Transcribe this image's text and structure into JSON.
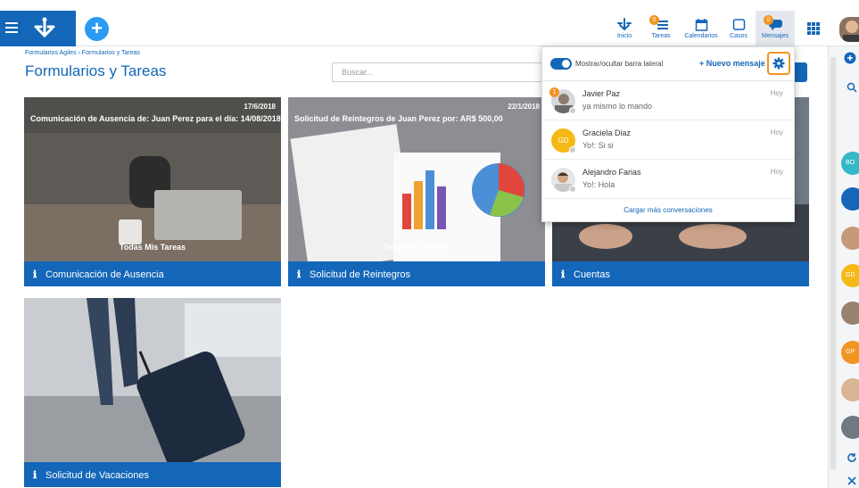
{
  "header": {
    "nav": [
      {
        "label": "Inicio"
      },
      {
        "label": "Tareas",
        "badge": "0"
      },
      {
        "label": "Calendarios"
      },
      {
        "label": "Casos"
      },
      {
        "label": "Mensajes",
        "badge": "0"
      }
    ]
  },
  "page": {
    "breadcrumb": "Formularios Agiles › Formularios y Tareas",
    "title": "Formularios y Tareas",
    "search_placeholder": "Buscar..."
  },
  "cards": [
    {
      "date": "17/6/2018",
      "description": "Comunicación de Ausencia de: Juan Perez para el día: 14/08/2018",
      "all_tasks": "Todas Mis Tareas",
      "label": "Comunicación de Ausencia"
    },
    {
      "date": "22/1/2018",
      "description": "Solicitud de Reintegros de Juan Perez por: AR$ 500,00",
      "all_tasks": "Todas Mis Tareas",
      "label": "Solicitud de Reintegros"
    },
    {
      "label": "Cuentas"
    },
    {
      "label": "Solicitud de Vacaciones"
    }
  ],
  "messages": {
    "toggle_label": "Mostrar/ocultar barra lateral",
    "toggle_on": true,
    "new_message": "+ Nuevo mensaje",
    "conversations": [
      {
        "name": "Javier Paz",
        "text": "ya mismo lo mando",
        "time": "Hoy",
        "badge": "1"
      },
      {
        "name": "Graciela Diaz",
        "text": "Yo!: Si si",
        "time": "Hoy",
        "initials": "GD"
      },
      {
        "name": "Alejandro Farias",
        "text": "Yo!: Hola",
        "time": "Hoy"
      }
    ],
    "load_more": "Cargar más conversaciones"
  },
  "rail": {
    "avatars": [
      {
        "initials": "BO",
        "color": "#35b7c7"
      },
      {
        "initials": "GD",
        "color": "#f5b915"
      },
      {
        "initials": "GP",
        "color": "#f29422"
      }
    ]
  },
  "colors": {
    "primary": "#1466b8",
    "accent": "#f29422",
    "button": "#2b9af3"
  }
}
